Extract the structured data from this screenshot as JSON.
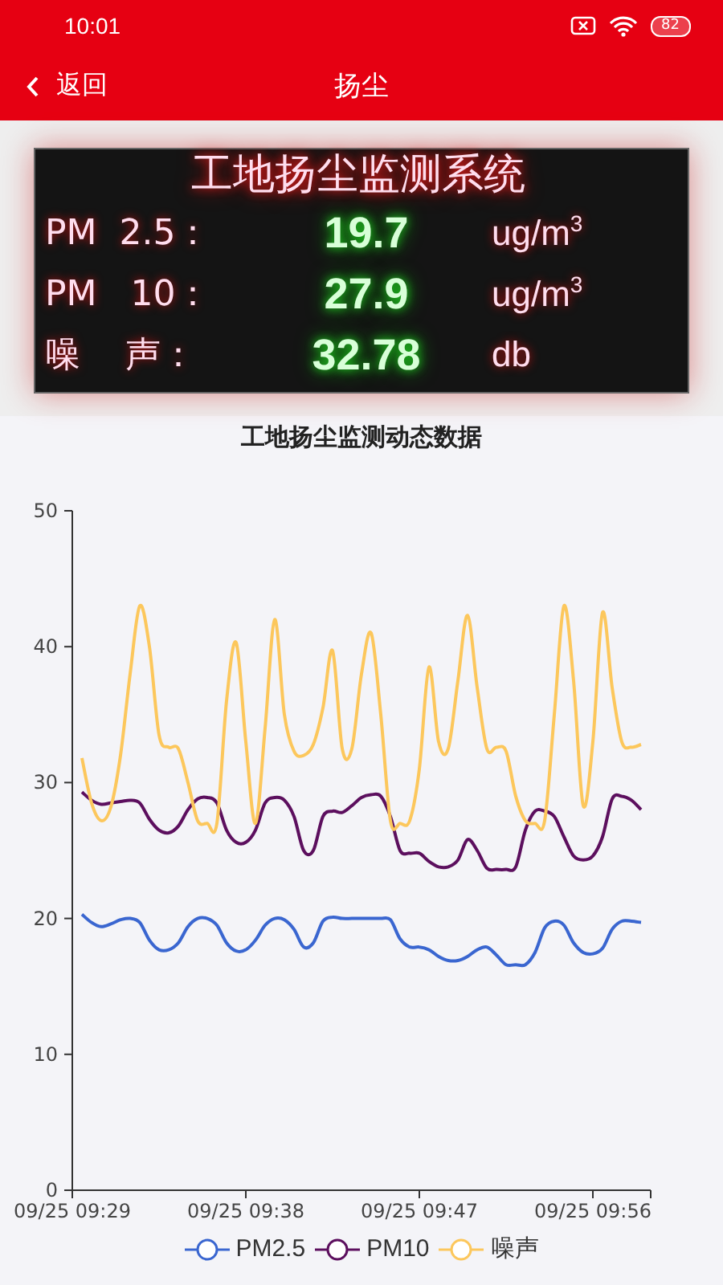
{
  "status_bar": {
    "time": "10:01",
    "battery": "82"
  },
  "header": {
    "back": "返回",
    "title": "扬尘"
  },
  "display": {
    "title": "工地扬尘监测系统",
    "rows": [
      {
        "label": "PM  2.5：",
        "value": "19.7",
        "unit": "ug/m$^{3}$"
      },
      {
        "label": "PM   10：",
        "value": "27.9",
        "unit": "ug/m$^{3}$"
      },
      {
        "label": "噪    声：",
        "value": "32.78",
        "unit": "db"
      }
    ]
  },
  "chart": {
    "title": "工地扬尘监测动态数据",
    "chart_data": {
      "type": "line",
      "ylim": [
        0,
        50
      ],
      "yticks": [
        0,
        10,
        20,
        30,
        40,
        50
      ],
      "categories": [
        "09/25 09:29",
        null,
        null,
        null,
        null,
        null,
        null,
        null,
        null,
        null,
        null,
        null,
        null,
        null,
        null,
        null,
        null,
        null,
        "09/25 09:38",
        null,
        null,
        null,
        null,
        null,
        null,
        null,
        null,
        null,
        null,
        null,
        null,
        null,
        null,
        null,
        null,
        null,
        "09/25 09:47",
        null,
        null,
        null,
        null,
        null,
        null,
        null,
        null,
        null,
        null,
        null,
        null,
        null,
        null,
        null,
        null,
        null,
        "09/25 09:56",
        null,
        null,
        null,
        null,
        null
      ],
      "series": [
        {
          "name": "PM2.5",
          "color": "#3a66d0",
          "values": [
            null,
            20.3,
            19.7,
            19.4,
            19.6,
            19.9,
            20,
            19.7,
            18.4,
            17.7,
            17.7,
            18.2,
            19.4,
            20,
            20,
            19.5,
            18.2,
            17.6,
            17.7,
            18.4,
            19.5,
            20,
            19.9,
            19.2,
            17.9,
            18.2,
            19.8,
            20.1,
            20,
            20,
            20,
            20,
            20,
            19.9,
            18.5,
            17.9,
            17.9,
            17.7,
            17.2,
            16.9,
            16.9,
            17.2,
            17.7,
            17.9,
            17.3,
            16.6,
            16.6,
            16.6,
            17.5,
            19.3,
            19.8,
            19.5,
            18.2,
            17.5,
            17.4,
            17.8,
            19.2,
            19.8,
            19.8,
            19.7
          ]
        },
        {
          "name": "PM10",
          "color": "#5c0f5e",
          "values": [
            null,
            29.3,
            28.7,
            28.4,
            28.5,
            28.6,
            28.7,
            28.5,
            27.3,
            26.5,
            26.3,
            26.8,
            28,
            28.8,
            28.9,
            28.5,
            26.5,
            25.6,
            25.6,
            26.5,
            28.5,
            28.9,
            28.7,
            27.5,
            25,
            25,
            27.5,
            27.9,
            27.8,
            28.3,
            28.9,
            29.1,
            29,
            27.5,
            25,
            24.8,
            24.8,
            24.2,
            23.8,
            23.8,
            24.3,
            25.8,
            25,
            23.7,
            23.6,
            23.6,
            23.8,
            26.5,
            27.9,
            27.9,
            27.5,
            26,
            24.6,
            24.3,
            24.6,
            26,
            28.8,
            29,
            28.7,
            28
          ]
        },
        {
          "name": "噪声",
          "color": "#fcc75c",
          "values": [
            null,
            31.8,
            28.5,
            27.2,
            28.2,
            32,
            38,
            43,
            40,
            33.5,
            32.6,
            32.5,
            30,
            27.2,
            27,
            27,
            36,
            40.3,
            33,
            27,
            34,
            42,
            35,
            32.3,
            32,
            32.8,
            35.5,
            39.7,
            32.5,
            32.5,
            38,
            41,
            35,
            27.2,
            27,
            27.2,
            31,
            38.5,
            33,
            32.5,
            37.5,
            42.3,
            37,
            32.5,
            32.6,
            32.3,
            29,
            27.2,
            27,
            27.2,
            35,
            43,
            37.5,
            28.3,
            33,
            42.5,
            37,
            33,
            32.6,
            32.8
          ]
        }
      ]
    }
  }
}
